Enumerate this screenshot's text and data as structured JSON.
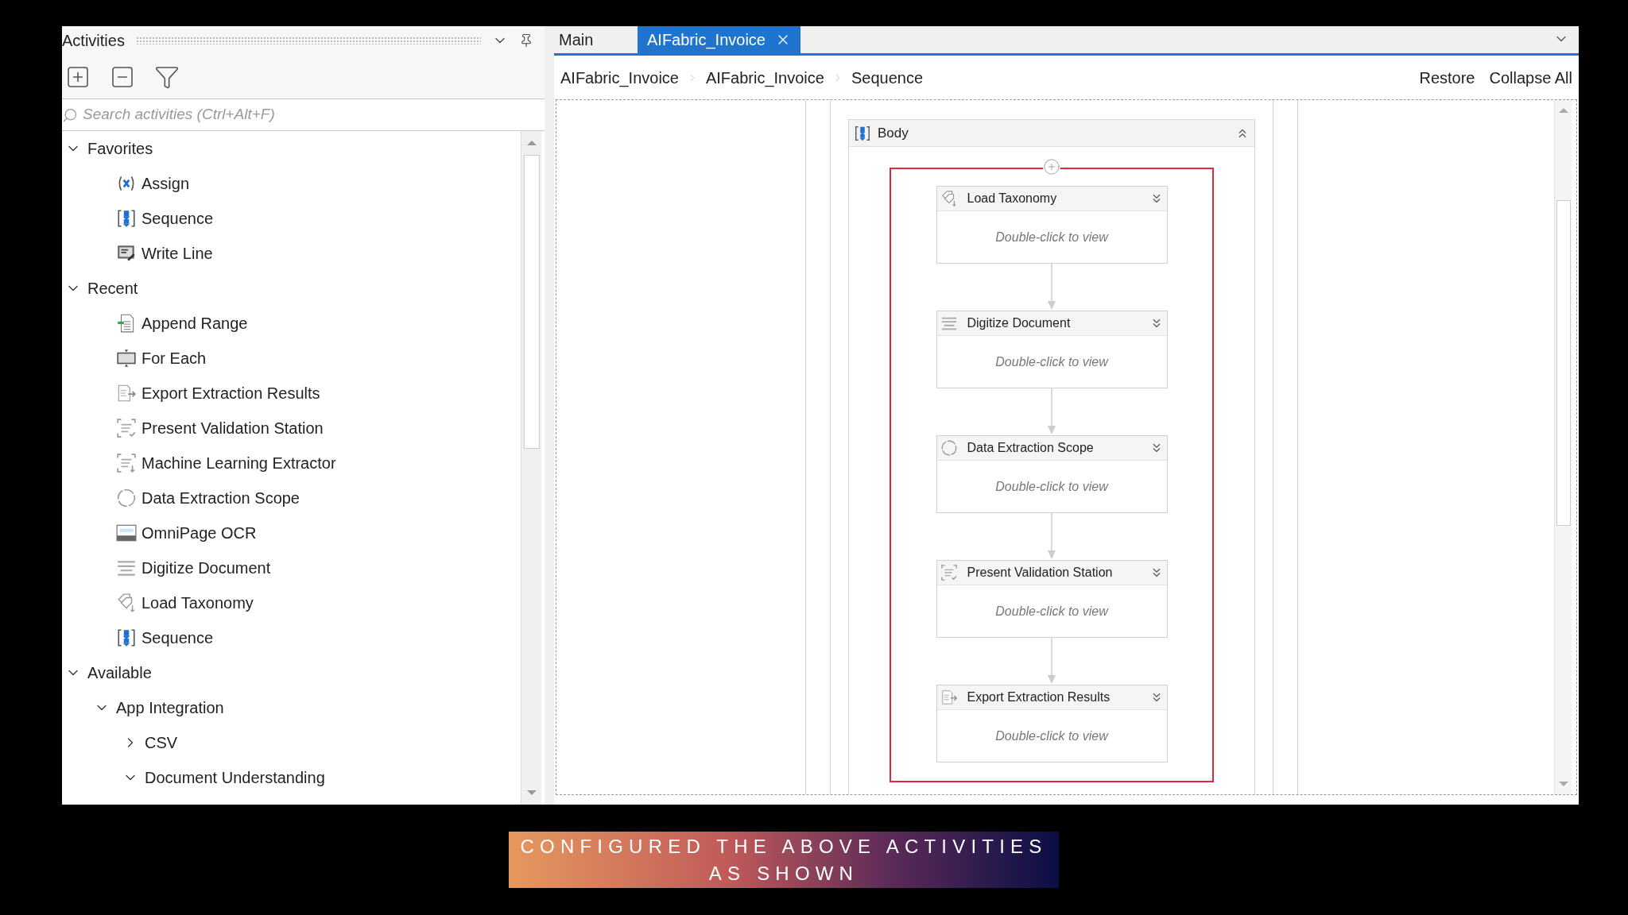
{
  "activities_panel": {
    "title": "Activities",
    "search": {
      "placeholder": "Search activities (Ctrl+Alt+F)"
    },
    "tree": [
      {
        "label": "Favorites",
        "expanded": true,
        "children": [
          {
            "label": "Assign",
            "kind": "assign"
          },
          {
            "label": "Sequence",
            "kind": "sequence"
          },
          {
            "label": "Write Line",
            "kind": "writeline"
          }
        ]
      },
      {
        "label": "Recent",
        "expanded": true,
        "children": [
          {
            "label": "Append Range",
            "kind": "append"
          },
          {
            "label": "For Each",
            "kind": "foreach"
          },
          {
            "label": "Export Extraction Results",
            "kind": "export"
          },
          {
            "label": "Present Validation Station",
            "kind": "validation"
          },
          {
            "label": "Machine Learning Extractor",
            "kind": "extractor"
          },
          {
            "label": "Data Extraction Scope",
            "kind": "scope"
          },
          {
            "label": "OmniPage OCR",
            "kind": "ocr"
          },
          {
            "label": "Digitize Document",
            "kind": "digitize"
          },
          {
            "label": "Load Taxonomy",
            "kind": "taxonomy"
          },
          {
            "label": "Sequence",
            "kind": "sequence"
          }
        ]
      },
      {
        "label": "Available",
        "expanded": true,
        "children": [
          {
            "label": "App Integration",
            "expanded": true,
            "children": [
              {
                "label": "CSV",
                "expanded": false
              },
              {
                "label": "Document Understanding",
                "expanded": true
              }
            ]
          }
        ]
      }
    ]
  },
  "tabs": [
    {
      "label": "Main",
      "selected": false
    },
    {
      "label": "AIFabric_Invoice",
      "selected": true
    }
  ],
  "breadcrumb": [
    "AIFabric_Invoice",
    "AIFabric_Invoice",
    "Sequence"
  ],
  "toolbar_links": [
    "Restore",
    "Collapse All"
  ],
  "designer": {
    "container": {
      "title": "Body",
      "expanded": true
    },
    "activities": [
      {
        "title": "Load Taxonomy",
        "hint": "Double-click to view",
        "kind": "taxonomy"
      },
      {
        "title": "Digitize Document",
        "hint": "Double-click to view",
        "kind": "digitize"
      },
      {
        "title": "Data Extraction Scope",
        "hint": "Double-click to view",
        "kind": "scope"
      },
      {
        "title": "Present Validation Station",
        "hint": "Double-click to view",
        "kind": "validation"
      },
      {
        "title": "Export Extraction Results",
        "hint": "Double-click to view",
        "kind": "export"
      }
    ]
  },
  "caption": {
    "lines": [
      "CONFIGURED THE ABOVE ACTIVITIES",
      "AS SHOWN"
    ]
  }
}
